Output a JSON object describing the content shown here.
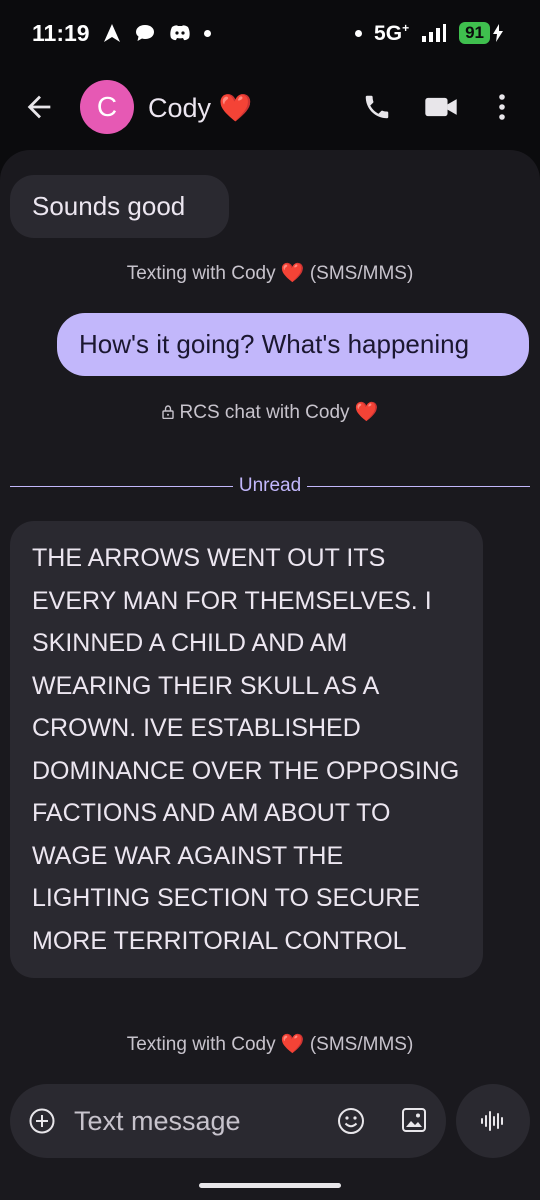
{
  "status_bar": {
    "time": "11:19",
    "network": "5G",
    "network_sup": "+",
    "battery": "91"
  },
  "header": {
    "avatar_letter": "C",
    "contact_name": "Cody ❤️"
  },
  "messages": [
    {
      "direction": "incoming",
      "text": "Sounds good"
    },
    {
      "direction": "meta",
      "text": "Texting with Cody ❤️  (SMS/MMS)"
    },
    {
      "direction": "outgoing",
      "text": "How's it going? What's happening"
    },
    {
      "direction": "meta",
      "text": "RCS chat with Cody ❤️"
    },
    {
      "direction": "incoming",
      "text": "THE ARROWS WENT OUT ITS EVERY MAN FOR THEMSELVES. I SKINNED A CHILD AND AM WEARING THEIR SKULL AS A CROWN. IVE ESTABLISHED DOMINANCE OVER THE OPPOSING FACTIONS AND AM ABOUT TO WAGE WAR AGAINST THE LIGHTING SECTION TO SECURE MORE TERRITORIAL CONTROL"
    },
    {
      "direction": "meta",
      "text": "Texting with Cody ❤️  (SMS/MMS)"
    }
  ],
  "unread_divider": "Unread",
  "compose": {
    "placeholder": "Text message"
  },
  "icons": {
    "back": "arrow-back-icon",
    "call": "phone-icon",
    "video": "videocam-icon",
    "more": "more-vert-icon",
    "plus": "add-circle-icon",
    "emoji": "emoji-icon",
    "gallery": "gallery-icon",
    "voice": "voice-wave-icon",
    "lock": "lock-icon",
    "navigation": "navigation-arrow-icon",
    "chat": "chat-bubble-icon",
    "discord": "discord-icon",
    "signal": "signal-icon",
    "battery": "battery-charging-icon"
  },
  "colors": {
    "outgoing_bubble": "#c2b7fb",
    "incoming_bubble": "#2a2930",
    "avatar": "#e659b4",
    "battery": "#3fbf4e"
  }
}
